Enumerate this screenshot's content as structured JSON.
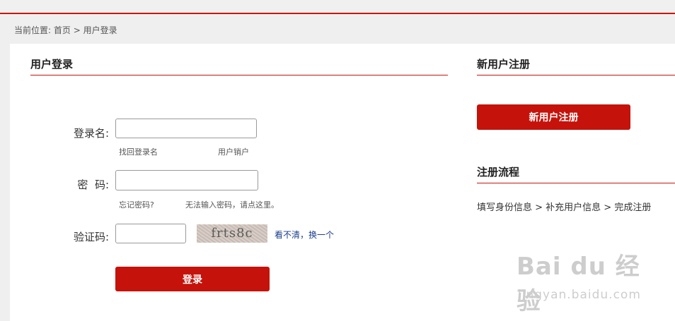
{
  "breadcrumb": {
    "prefix": "当前位置:",
    "home": "首页",
    "separator": ">",
    "current": "用户登录"
  },
  "login": {
    "title": "用户登录",
    "username_label": "登录名:",
    "username_value": "",
    "find_username_link": "找回登录名",
    "cancel_account_link": "用户销户",
    "password_label": "密  码:",
    "password_value": "",
    "forgot_password_link": "忘记密码?",
    "cannot_input_link": "无法输入密码，请点这里。",
    "captcha_label": "验证码:",
    "captcha_value": "",
    "captcha_text": "frts8c",
    "refresh_captcha_link": "看不清，换一个",
    "submit_label": "登录"
  },
  "register": {
    "title": "新用户注册",
    "button_label": "新用户注册",
    "flow_title": "注册流程",
    "flow_text": "填写身份信息 > 补充用户信息 > 完成注册"
  },
  "watermark": {
    "brand": "Bai du 经验",
    "url": "jingyan.baidu.com"
  },
  "colors": {
    "accent": "#c8160c",
    "button": "#c5120a",
    "link": "#1a3d8a",
    "background": "#efefef"
  }
}
